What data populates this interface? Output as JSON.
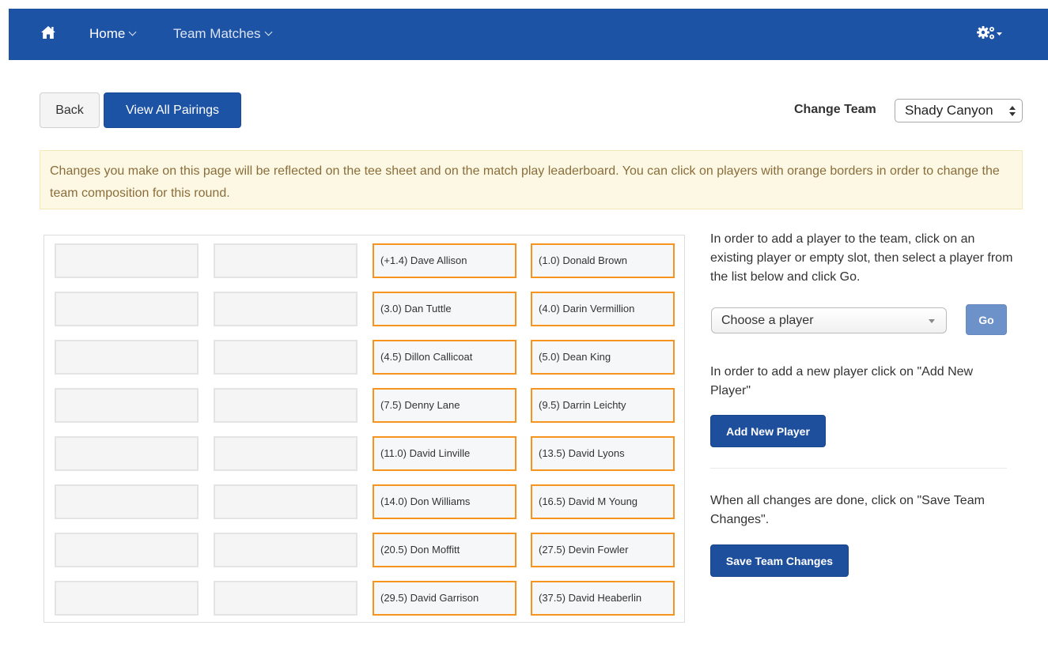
{
  "nav": {
    "home_icon": "home-icon",
    "items": [
      {
        "label": "Home"
      },
      {
        "label": "Team Matches"
      }
    ],
    "settings_icon": "gears-icon"
  },
  "toolbar": {
    "back_label": "Back",
    "pairings_label": "View All Pairings",
    "change_team_label": "Change Team",
    "team_value": "Shady Canyon"
  },
  "notice": {
    "text": "Changes you make on this page will be reflected on the tee sheet and on the match play leaderboard. You can click on players with orange borders in order to change the team composition for this round."
  },
  "grid": {
    "rows": [
      {
        "p1": "(+1.4) Dave Allison",
        "p2": "(1.0) Donald Brown"
      },
      {
        "p1": "(3.0) Dan Tuttle",
        "p2": "(4.0) Darin Vermillion"
      },
      {
        "p1": "(4.5) Dillon Callicoat",
        "p2": "(5.0) Dean King"
      },
      {
        "p1": "(7.5) Denny Lane",
        "p2": "(9.5) Darrin Leichty"
      },
      {
        "p1": "(11.0) David Linville",
        "p2": "(13.5) David Lyons"
      },
      {
        "p1": "(14.0) Don Williams",
        "p2": "(16.5) David M Young"
      },
      {
        "p1": "(20.5) Don Moffitt",
        "p2": "(27.5) Devin Fowler"
      },
      {
        "p1": "(29.5) David Garrison",
        "p2": "(37.5) David Heaberlin"
      }
    ],
    "accent_color": "#f7941d"
  },
  "side": {
    "add_existing_text": "In order to add a player to the team, click on an existing player or empty slot, then select a player from the list below and click Go.",
    "player_select_placeholder": "Choose a player",
    "go_label": "Go",
    "add_new_text": "In order to add a new player click on \"Add New Player\"",
    "add_new_label": "Add New Player",
    "save_text": "When all changes are done, click on \"Save Team Changes\".",
    "save_label": "Save Team Changes"
  },
  "colors": {
    "brand": "#1d53a5",
    "notice_bg": "#fcf8e3",
    "notice_text": "#8a6d3b"
  }
}
